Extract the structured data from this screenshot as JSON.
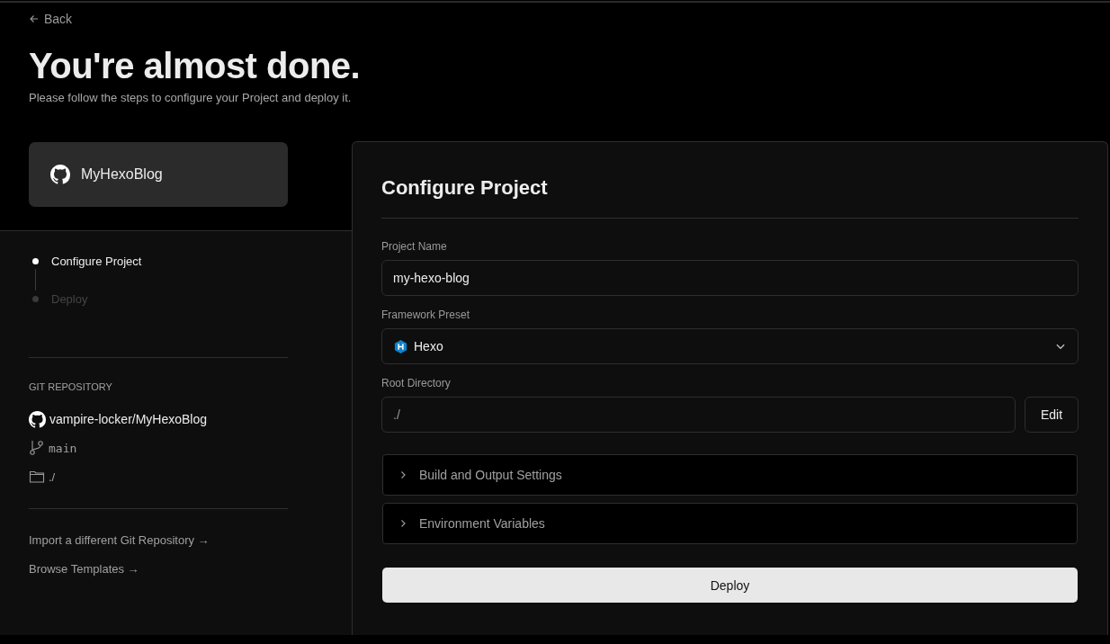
{
  "back_link": "Back",
  "title": "You're almost done.",
  "subtitle": "Please follow the steps to configure your Project and deploy it.",
  "repo_card": {
    "name": "MyHexoBlog"
  },
  "steps": [
    {
      "label": "Configure Project",
      "selected": true
    },
    {
      "label": "Deploy",
      "selected": false
    }
  ],
  "git_repository": {
    "heading": "GIT REPOSITORY",
    "repo": "vampire-locker/MyHexoBlog",
    "branch": "main",
    "directory": "./"
  },
  "links": [
    "Import a different Git Repository →",
    "Browse Templates →"
  ],
  "configure": {
    "title": "Configure Project",
    "project_name": {
      "label": "Project Name",
      "value": "my-hexo-blog"
    },
    "framework_preset": {
      "label": "Framework Preset",
      "value": "Hexo"
    },
    "root_directory": {
      "label": "Root Directory",
      "value": "./",
      "button": "Edit"
    },
    "sections": [
      {
        "label": "Build and Output Settings",
        "expanded": false
      },
      {
        "label": "Environment Variables",
        "expanded": false
      }
    ],
    "deploy_button": "Deploy"
  }
}
